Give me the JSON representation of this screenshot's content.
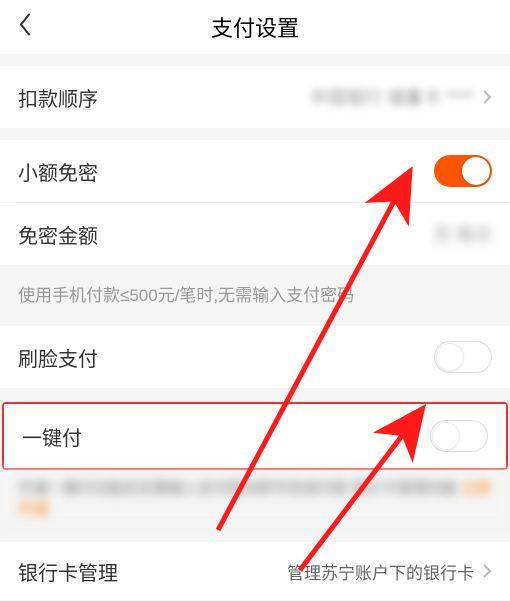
{
  "header": {
    "title": "支付设置"
  },
  "rows": {
    "deduction_order": {
      "label": "扣款顺序",
      "value": "中国银行 储蓄卡 ****"
    },
    "small_free": {
      "label": "小额免密"
    },
    "free_amount": {
      "label": "免密金额",
      "value": "无 每次"
    },
    "hint": "使用手机付款≤500元/笔时,无需输入支付密码",
    "face_pay": {
      "label": "刷脸支付"
    },
    "one_click": {
      "label": "一键付"
    },
    "blur_text": "开通一键付功能后无需输入支付密码即可完成付款 银行卡管理功能",
    "bank_mgmt": {
      "label": "银行卡管理",
      "sub": "管理苏宁账户下的银行卡"
    }
  }
}
